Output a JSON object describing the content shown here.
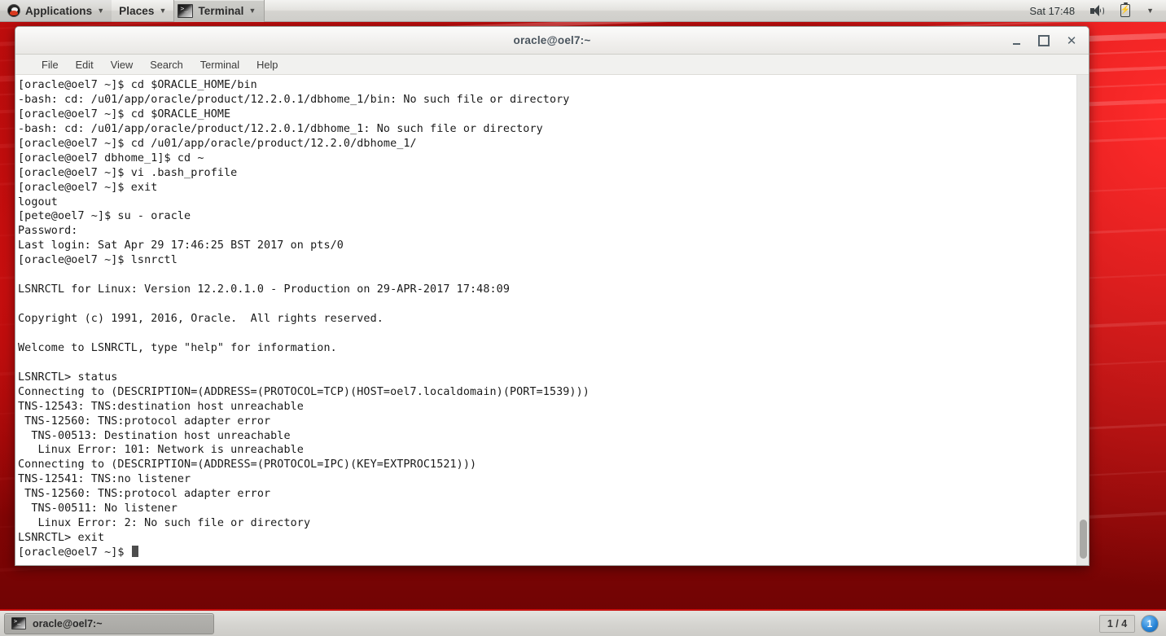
{
  "top_panel": {
    "applications_label": "Applications",
    "places_label": "Places",
    "active_task_label": "Terminal",
    "clock": "Sat 17:48",
    "terminal_icon_glyph": ">_",
    "icons": {
      "distro": "distro-logo-icon",
      "terminal": "terminal-icon",
      "volume": "speaker-icon",
      "battery": "battery-icon",
      "dropdown": "chevron-down-icon"
    },
    "caret_glyph": "▼"
  },
  "window": {
    "title": "oracle@oel7:~",
    "buttons": {
      "minimize": "minimize-button",
      "maximize": "maximize-button",
      "close_glyph": "✕"
    },
    "menu": [
      "File",
      "Edit",
      "View",
      "Search",
      "Terminal",
      "Help"
    ]
  },
  "terminal": {
    "lines": [
      "[oracle@oel7 ~]$ cd $ORACLE_HOME/bin",
      "-bash: cd: /u01/app/oracle/product/12.2.0.1/dbhome_1/bin: No such file or directory",
      "[oracle@oel7 ~]$ cd $ORACLE_HOME",
      "-bash: cd: /u01/app/oracle/product/12.2.0.1/dbhome_1: No such file or directory",
      "[oracle@oel7 ~]$ cd /u01/app/oracle/product/12.2.0/dbhome_1/",
      "[oracle@oel7 dbhome_1]$ cd ~",
      "[oracle@oel7 ~]$ vi .bash_profile",
      "[oracle@oel7 ~]$ exit",
      "logout",
      "[pete@oel7 ~]$ su - oracle",
      "Password:",
      "Last login: Sat Apr 29 17:46:25 BST 2017 on pts/0",
      "[oracle@oel7 ~]$ lsnrctl",
      "",
      "LSNRCTL for Linux: Version 12.2.0.1.0 - Production on 29-APR-2017 17:48:09",
      "",
      "Copyright (c) 1991, 2016, Oracle.  All rights reserved.",
      "",
      "Welcome to LSNRCTL, type \"help\" for information.",
      "",
      "LSNRCTL> status",
      "Connecting to (DESCRIPTION=(ADDRESS=(PROTOCOL=TCP)(HOST=oel7.localdomain)(PORT=1539)))",
      "TNS-12543: TNS:destination host unreachable",
      " TNS-12560: TNS:protocol adapter error",
      "  TNS-00513: Destination host unreachable",
      "   Linux Error: 101: Network is unreachable",
      "Connecting to (DESCRIPTION=(ADDRESS=(PROTOCOL=IPC)(KEY=EXTPROC1521)))",
      "TNS-12541: TNS:no listener",
      " TNS-12560: TNS:protocol adapter error",
      "  TNS-00511: No listener",
      "   Linux Error: 2: No such file or directory",
      "LSNRCTL> exit"
    ],
    "prompt": "[oracle@oel7 ~]$ ",
    "cursor": "block"
  },
  "bottom_panel": {
    "window_button_label": "oracle@oel7:~",
    "workspace_indicator": "1 / 4",
    "notification_count": "1"
  },
  "colors": {
    "desktop_red": "#b00d0d",
    "panel_grey": "#d6d5d1",
    "accent_red": "#c9100f",
    "terminal_bg": "#ffffff",
    "terminal_fg": "#1a1a1a",
    "title_fg": "#4a555e",
    "notify_blue": "#2a86d8"
  }
}
